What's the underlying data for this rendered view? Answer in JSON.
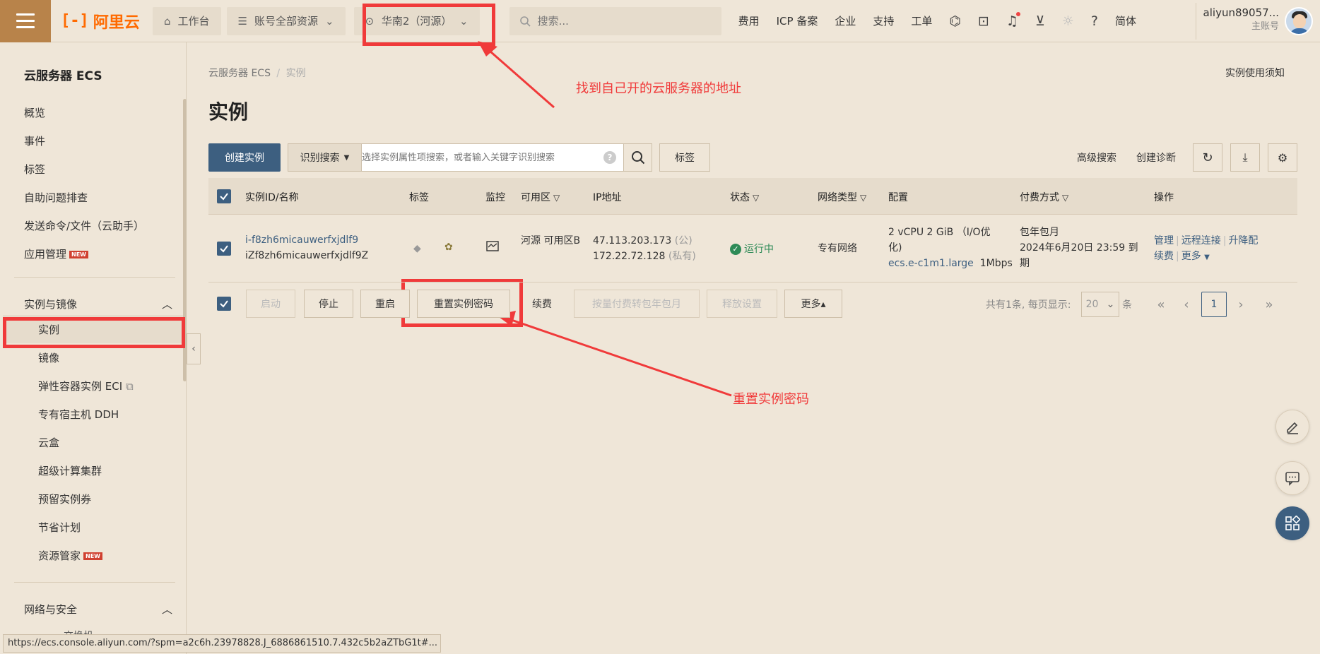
{
  "header": {
    "logo_text": "阿里云",
    "workbench": "工作台",
    "resources": "账号全部资源",
    "region": "华南2（河源）",
    "search_placeholder": "搜索...",
    "nav": [
      "费用",
      "ICP 备案",
      "企业",
      "支持",
      "工单"
    ],
    "lang": "简体",
    "account_name": "aliyun89057...",
    "account_role": "主账号"
  },
  "sidebar": {
    "title": "云服务器 ECS",
    "items": [
      "概览",
      "事件",
      "标签",
      "自助问题排查",
      "发送命令/文件（云助手）",
      "应用管理"
    ],
    "new_badge": "NEW",
    "group1": "实例与镜像",
    "group1_items": [
      "实例",
      "镜像",
      "弹性容器实例 ECI",
      "专有宿主机 DDH",
      "云盒",
      "超级计算集群",
      "预留实例券",
      "节省计划",
      "资源管家"
    ],
    "group2": "网络与安全",
    "cut_item": "交换机"
  },
  "breadcrumb": {
    "root": "云服务器 ECS",
    "sep": "/",
    "current": "实例"
  },
  "notice_link": "实例使用须知",
  "page_title": "实例",
  "annotations": {
    "top": "找到自己开的云服务器的地址",
    "bottom": "重置实例密码"
  },
  "toolbar": {
    "create": "创建实例",
    "search_type": "识别搜索",
    "filter_placeholder": "选择实例属性项搜索，或者输入关键字识别搜索",
    "tag": "标签",
    "advanced_search": "高级搜索",
    "diagnose": "创建诊断"
  },
  "table": {
    "headers": [
      "实例ID/名称",
      "标签",
      "监控",
      "可用区",
      "IP地址",
      "状态",
      "网络类型",
      "配置",
      "付费方式",
      "操作"
    ],
    "row": {
      "id": "i-f8zh6micauwerfxjdlf9",
      "name": "iZf8zh6micauwerfxjdlf9Z",
      "zone": "河源 可用区B",
      "ip_public": "47.113.203.173",
      "ip_public_tag": "(公)",
      "ip_private": "172.22.72.128",
      "ip_private_tag": "(私有)",
      "status": "运行中",
      "network": "专有网络",
      "config_line1": "2 vCPU 2 GiB （I/O优",
      "config_line2": "化)",
      "config_type": "ecs.e-c1m1.large",
      "config_bw": "1Mbps",
      "billing_type": "包年包月",
      "billing_expiry": "2024年6月20日 23:59 到期",
      "ops": [
        "管理",
        "远程连接",
        "升降配",
        "续费",
        "更多"
      ]
    }
  },
  "actions": {
    "start": "启动",
    "stop": "停止",
    "restart": "重启",
    "reset_password": "重置实例密码",
    "renew": "续费",
    "convert": "按量付费转包年包月",
    "release": "释放设置",
    "more": "更多▴"
  },
  "pager": {
    "summary": "共有1条, 每页显示:",
    "page_size": "20",
    "unit": "条",
    "current": "1"
  },
  "status_url": "https://ecs.console.aliyun.com/?spm=a2c6h.23978828.J_6886861510.7.432c5b2aZTbG1t#..."
}
